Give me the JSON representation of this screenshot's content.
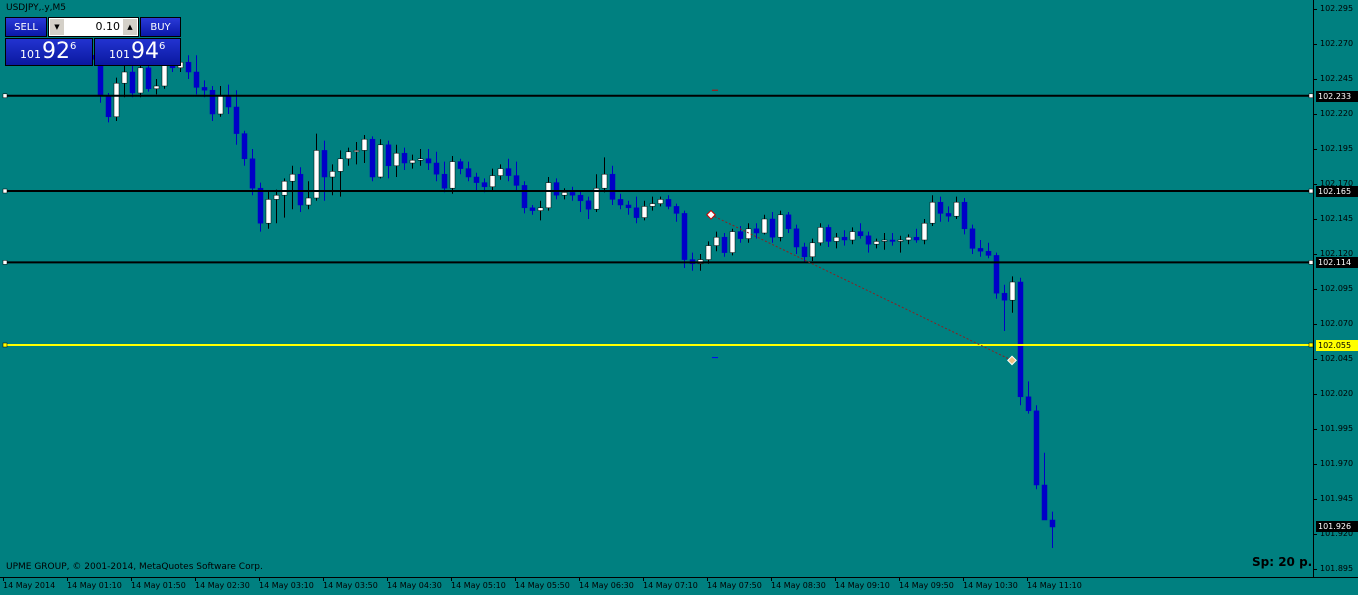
{
  "window": {
    "title": "USDJPY,.y,M5"
  },
  "trade_panel": {
    "sell_label": "SELL",
    "buy_label": "BUY",
    "lot_value": "0.10",
    "sell_price": {
      "prefix": "101",
      "big": "92",
      "sup": "6"
    },
    "buy_price": {
      "prefix": "101",
      "big": "94",
      "sup": "6"
    }
  },
  "footer": {
    "copyright": "UPME GROUP, © 2001-2014, MetaQuotes Software Corp.",
    "spread": "Sp: 20 p."
  },
  "colors": {
    "background": "#008080",
    "bull_candle": "#ffffff",
    "bear_candle": "#0000c8",
    "horizontal_line": "#000000",
    "bid_line": "#ffff00"
  },
  "chart_data": {
    "type": "candlestick",
    "symbol": "USDJPY",
    "timeframe": "M5",
    "y_ticks": [
      "102.295",
      "102.270",
      "102.245",
      "102.220",
      "102.195",
      "102.170",
      "102.145",
      "102.120",
      "102.095",
      "102.070",
      "102.045",
      "102.020",
      "101.995",
      "101.970",
      "101.945",
      "101.920",
      "101.895"
    ],
    "x_ticks": [
      "14 May 2014",
      "14 May 01:10",
      "14 May 01:50",
      "14 May 02:30",
      "14 May 03:10",
      "14 May 03:50",
      "14 May 04:30",
      "14 May 05:10",
      "14 May 05:50",
      "14 May 06:30",
      "14 May 07:10",
      "14 May 07:50",
      "14 May 08:30",
      "14 May 09:10",
      "14 May 09:50",
      "14 May 10:30",
      "14 May 11:10"
    ],
    "horizontal_lines": [
      {
        "label": "102.233",
        "value": 102.233,
        "style": "black"
      },
      {
        "label": "102.165",
        "value": 102.165,
        "style": "black"
      },
      {
        "label": "102.114",
        "value": 102.114,
        "style": "black"
      },
      {
        "label": "102.055",
        "value": 102.055,
        "style": "yellow"
      }
    ],
    "current_price": {
      "label": "101.926",
      "value": 101.926
    },
    "candles": [
      [
        102.262,
        102.265,
        102.256,
        102.259
      ],
      [
        102.259,
        102.262,
        102.228,
        102.233
      ],
      [
        102.233,
        102.235,
        102.214,
        102.218
      ],
      [
        102.218,
        102.246,
        102.215,
        102.242
      ],
      [
        102.242,
        102.255,
        102.232,
        102.25
      ],
      [
        102.25,
        102.256,
        102.232,
        102.235
      ],
      [
        102.235,
        102.256,
        102.232,
        102.253
      ],
      [
        102.253,
        102.256,
        102.236,
        102.238
      ],
      [
        102.238,
        102.245,
        102.234,
        102.24
      ],
      [
        102.24,
        102.262,
        102.238,
        102.256
      ],
      [
        102.256,
        102.262,
        102.25,
        102.253
      ],
      [
        102.253,
        102.26,
        102.25,
        102.257
      ],
      [
        102.257,
        102.262,
        102.245,
        102.25
      ],
      [
        102.25,
        102.262,
        102.234,
        102.239
      ],
      [
        102.239,
        102.244,
        102.232,
        102.237
      ],
      [
        102.237,
        102.24,
        102.215,
        102.22
      ],
      [
        102.22,
        102.24,
        102.218,
        102.233
      ],
      [
        102.233,
        102.241,
        102.22,
        102.225
      ],
      [
        102.225,
        102.237,
        102.198,
        102.206
      ],
      [
        102.206,
        102.208,
        102.183,
        102.188
      ],
      [
        102.188,
        102.195,
        102.162,
        102.167
      ],
      [
        102.167,
        102.171,
        102.136,
        102.142
      ],
      [
        102.142,
        102.165,
        102.138,
        102.159
      ],
      [
        102.159,
        102.166,
        102.142,
        102.162
      ],
      [
        102.162,
        102.174,
        102.146,
        102.172
      ],
      [
        102.172,
        102.183,
        102.152,
        102.177
      ],
      [
        102.177,
        102.182,
        102.15,
        102.155
      ],
      [
        102.155,
        102.172,
        102.152,
        102.16
      ],
      [
        102.16,
        102.206,
        102.158,
        102.194
      ],
      [
        102.194,
        102.201,
        102.158,
        102.175
      ],
      [
        102.175,
        102.184,
        102.162,
        102.179
      ],
      [
        102.179,
        102.194,
        102.161,
        102.188
      ],
      [
        102.188,
        102.196,
        102.183,
        102.193
      ],
      [
        102.193,
        102.2,
        102.184,
        102.194
      ],
      [
        102.194,
        102.205,
        102.185,
        102.202
      ],
      [
        102.202,
        102.204,
        102.172,
        102.175
      ],
      [
        102.175,
        102.202,
        102.174,
        102.198
      ],
      [
        102.198,
        102.201,
        102.174,
        102.183
      ],
      [
        102.183,
        102.198,
        102.175,
        102.192
      ],
      [
        102.192,
        102.196,
        102.18,
        102.185
      ],
      [
        102.185,
        102.191,
        102.181,
        102.187
      ],
      [
        102.187,
        102.195,
        102.183,
        102.188
      ],
      [
        102.188,
        102.195,
        102.18,
        102.185
      ],
      [
        102.185,
        102.193,
        102.172,
        102.177
      ],
      [
        102.177,
        102.186,
        102.164,
        102.167
      ],
      [
        102.167,
        102.19,
        102.163,
        102.186
      ],
      [
        102.186,
        102.188,
        102.177,
        102.181
      ],
      [
        102.181,
        102.186,
        102.172,
        102.175
      ],
      [
        102.175,
        102.178,
        102.165,
        102.171
      ],
      [
        102.171,
        102.174,
        102.164,
        102.168
      ],
      [
        102.168,
        102.181,
        102.165,
        102.176
      ],
      [
        102.176,
        102.184,
        102.173,
        102.181
      ],
      [
        102.181,
        102.188,
        102.172,
        102.176
      ],
      [
        102.176,
        102.186,
        102.165,
        102.169
      ],
      [
        102.169,
        102.172,
        102.149,
        102.153
      ],
      [
        102.153,
        102.155,
        102.148,
        102.151
      ],
      [
        102.151,
        102.158,
        102.144,
        102.153
      ],
      [
        102.153,
        102.175,
        102.151,
        102.171
      ],
      [
        102.171,
        102.174,
        102.159,
        102.162
      ],
      [
        102.162,
        102.167,
        102.159,
        102.164
      ],
      [
        102.164,
        102.168,
        102.158,
        102.162
      ],
      [
        102.162,
        102.165,
        102.15,
        102.158
      ],
      [
        102.158,
        102.161,
        102.145,
        102.152
      ],
      [
        102.152,
        102.177,
        102.15,
        102.167
      ],
      [
        102.167,
        102.189,
        102.164,
        102.177
      ],
      [
        102.177,
        102.183,
        102.155,
        102.159
      ],
      [
        102.159,
        102.163,
        102.152,
        102.155
      ],
      [
        102.155,
        102.158,
        102.148,
        102.153
      ],
      [
        102.153,
        102.161,
        102.142,
        102.146
      ],
      [
        102.146,
        102.158,
        102.144,
        102.154
      ],
      [
        102.154,
        102.161,
        102.151,
        102.156
      ],
      [
        102.156,
        102.161,
        102.154,
        102.159
      ],
      [
        102.159,
        102.162,
        102.152,
        102.154
      ],
      [
        102.154,
        102.156,
        102.143,
        102.149
      ],
      [
        102.149,
        102.151,
        102.11,
        102.116
      ],
      [
        102.116,
        102.121,
        102.108,
        102.113
      ],
      [
        102.113,
        102.12,
        102.108,
        102.116
      ],
      [
        102.116,
        102.129,
        102.113,
        102.126
      ],
      [
        102.126,
        102.136,
        102.122,
        102.132
      ],
      [
        102.132,
        102.135,
        102.118,
        102.121
      ],
      [
        102.121,
        102.138,
        102.119,
        102.136
      ],
      [
        102.136,
        102.14,
        102.128,
        102.131
      ],
      [
        102.131,
        102.142,
        102.128,
        102.138
      ],
      [
        102.138,
        102.142,
        102.131,
        102.135
      ],
      [
        102.135,
        102.148,
        102.134,
        102.145
      ],
      [
        102.145,
        102.15,
        102.128,
        102.132
      ],
      [
        102.132,
        102.151,
        102.129,
        102.148
      ],
      [
        102.148,
        102.15,
        102.135,
        102.138
      ],
      [
        102.138,
        102.141,
        102.12,
        102.125
      ],
      [
        102.125,
        102.128,
        102.114,
        102.118
      ],
      [
        102.118,
        102.131,
        102.115,
        102.128
      ],
      [
        102.128,
        102.142,
        102.126,
        102.139
      ],
      [
        102.139,
        102.141,
        102.125,
        102.129
      ],
      [
        102.129,
        102.135,
        102.124,
        102.132
      ],
      [
        102.132,
        102.137,
        102.126,
        102.13
      ],
      [
        102.13,
        102.139,
        102.127,
        102.136
      ],
      [
        102.136,
        102.142,
        102.131,
        102.133
      ],
      [
        102.133,
        102.136,
        102.121,
        102.127
      ],
      [
        102.127,
        102.131,
        102.124,
        102.129
      ],
      [
        102.129,
        102.135,
        102.123,
        102.13
      ],
      [
        102.13,
        102.135,
        102.126,
        102.129
      ],
      [
        102.129,
        102.133,
        102.121,
        102.13
      ],
      [
        102.13,
        102.134,
        102.127,
        102.132
      ],
      [
        102.132,
        102.138,
        102.128,
        102.13
      ],
      [
        102.13,
        102.145,
        102.127,
        102.142
      ],
      [
        102.142,
        102.162,
        102.14,
        102.157
      ],
      [
        102.157,
        102.161,
        102.143,
        102.149
      ],
      [
        102.149,
        102.154,
        102.143,
        102.147
      ],
      [
        102.147,
        102.161,
        102.145,
        102.157
      ],
      [
        102.157,
        102.16,
        102.134,
        102.138
      ],
      [
        102.138,
        102.141,
        102.12,
        102.124
      ],
      [
        102.124,
        102.13,
        102.118,
        102.122
      ],
      [
        102.122,
        102.128,
        102.117,
        102.119
      ],
      [
        102.119,
        102.121,
        102.088,
        102.092
      ],
      [
        102.092,
        102.098,
        102.065,
        102.087
      ],
      [
        102.087,
        102.104,
        102.078,
        102.1
      ],
      [
        102.1,
        102.103,
        102.012,
        102.018
      ],
      [
        102.018,
        102.029,
        102.006,
        102.008
      ],
      [
        102.008,
        102.012,
        101.952,
        101.955
      ],
      [
        101.955,
        101.978,
        101.935,
        101.93
      ],
      [
        101.93,
        101.936,
        101.91,
        101.925
      ]
    ]
  }
}
